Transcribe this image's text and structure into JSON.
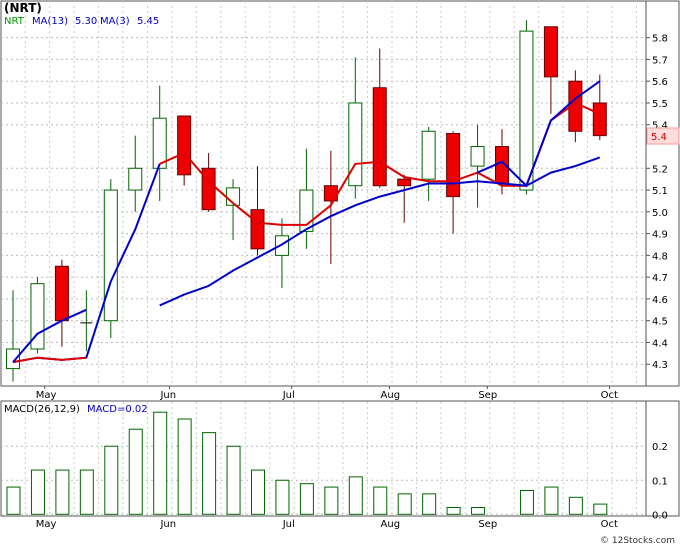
{
  "chart_data": [
    {
      "type": "candlestick",
      "ticker_label": "(NRT)",
      "legend": [
        {
          "text": "NRT",
          "color": "#009900"
        },
        {
          "text": "MA(13)",
          "color": "#0000cc"
        },
        {
          "text": "5.30",
          "color": "#0000cc"
        },
        {
          "text": "MA(3)",
          "color": "#0000cc"
        },
        {
          "text": "5.45",
          "color": "#0000cc"
        }
      ],
      "current_price_label": "5.4",
      "y_ticks": [
        "4.3",
        "4.4",
        "4.5",
        "4.6",
        "4.7",
        "4.8",
        "4.9",
        "5.0",
        "5.1",
        "5.2",
        "5.4",
        "5.5",
        "5.6",
        "5.7",
        "5.8"
      ],
      "ylim": [
        4.2,
        5.95
      ],
      "x_month_labels": [
        {
          "label": "May",
          "index": 1.3
        },
        {
          "label": "Jun",
          "index": 6.4
        },
        {
          "label": "Jul",
          "index": 11.4
        },
        {
          "label": "Aug",
          "index": 15.4
        },
        {
          "label": "Sep",
          "index": 19.4
        },
        {
          "label": "Oct",
          "index": 24.4
        }
      ],
      "candles": [
        {
          "o": 4.28,
          "h": 4.64,
          "l": 4.22,
          "c": 4.37
        },
        {
          "o": 4.37,
          "h": 4.7,
          "l": 4.35,
          "c": 4.67
        },
        {
          "o": 4.75,
          "h": 4.78,
          "l": 4.38,
          "c": 4.5
        },
        {
          "o": 4.49,
          "h": 4.64,
          "l": 4.36,
          "c": 4.49
        },
        {
          "o": 4.5,
          "h": 5.15,
          "l": 4.42,
          "c": 5.1
        },
        {
          "o": 5.1,
          "h": 5.35,
          "l": 5.0,
          "c": 5.2
        },
        {
          "o": 5.2,
          "h": 5.58,
          "l": 5.05,
          "c": 5.43
        },
        {
          "o": 5.44,
          "h": 5.44,
          "l": 5.12,
          "c": 5.17
        },
        {
          "o": 5.2,
          "h": 5.27,
          "l": 5.0,
          "c": 5.01
        },
        {
          "o": 5.03,
          "h": 5.15,
          "l": 4.87,
          "c": 5.11
        },
        {
          "o": 5.01,
          "h": 5.21,
          "l": 4.8,
          "c": 4.83
        },
        {
          "o": 4.8,
          "h": 4.97,
          "l": 4.65,
          "c": 4.89
        },
        {
          "o": 4.91,
          "h": 5.29,
          "l": 4.83,
          "c": 5.1
        },
        {
          "o": 5.12,
          "h": 5.28,
          "l": 4.76,
          "c": 5.05
        },
        {
          "o": 5.12,
          "h": 5.71,
          "l": 5.06,
          "c": 5.5
        },
        {
          "o": 5.57,
          "h": 5.75,
          "l": 5.11,
          "c": 5.12
        },
        {
          "o": 5.15,
          "h": 5.17,
          "l": 4.95,
          "c": 5.12
        },
        {
          "o": 5.15,
          "h": 5.39,
          "l": 5.05,
          "c": 5.37
        },
        {
          "o": 5.36,
          "h": 5.37,
          "l": 4.9,
          "c": 5.07
        },
        {
          "o": 5.21,
          "h": 5.4,
          "l": 5.02,
          "c": 5.3
        },
        {
          "o": 5.3,
          "h": 5.38,
          "l": 5.08,
          "c": 5.13
        },
        {
          "o": 5.1,
          "h": 5.88,
          "l": 5.08,
          "c": 5.83
        },
        {
          "o": 5.85,
          "h": 5.85,
          "l": 5.45,
          "c": 5.62
        },
        {
          "o": 5.6,
          "h": 5.65,
          "l": 5.32,
          "c": 5.37
        },
        {
          "o": 5.5,
          "h": 5.63,
          "l": 5.33,
          "c": 5.35
        }
      ],
      "ma3": [
        4.31,
        4.33,
        4.32,
        4.33,
        null,
        null,
        5.22,
        5.27,
        5.14,
        5.04,
        4.95,
        4.94,
        4.94,
        5.03,
        5.22,
        5.23,
        5.16,
        5.14,
        5.14,
        5.18,
        5.12,
        5.12,
        5.42,
        5.5,
        5.45
      ],
      "ma3_main": [
        4.31,
        4.33,
        4.32,
        4.33,
        4.68,
        4.92,
        5.22
      ],
      "ma13": [
        4.31,
        4.44,
        4.5,
        4.55,
        4.69,
        4.85,
        4.57,
        4.62,
        4.66,
        4.73,
        4.79,
        4.85,
        4.92,
        4.98,
        5.03,
        5.07,
        5.1,
        5.13,
        5.13,
        5.14,
        5.13,
        5.12,
        5.18,
        5.21,
        5.25
      ]
    },
    {
      "type": "bar",
      "indicator_label": "MACD(26,12,9)",
      "value_label": "MACD=0.02",
      "y_ticks": [
        "0.0",
        "0.1",
        "0.2"
      ],
      "ylim": [
        -0.005,
        0.33
      ],
      "values": [
        0.08,
        0.13,
        0.13,
        0.13,
        0.2,
        0.25,
        0.3,
        0.28,
        0.24,
        0.2,
        0.13,
        0.1,
        0.09,
        0.08,
        0.11,
        0.08,
        0.06,
        0.06,
        0.02,
        0.02,
        null,
        0.07,
        0.08,
        0.05,
        0.03
      ]
    }
  ],
  "watermark": "© 12Stocks.com"
}
